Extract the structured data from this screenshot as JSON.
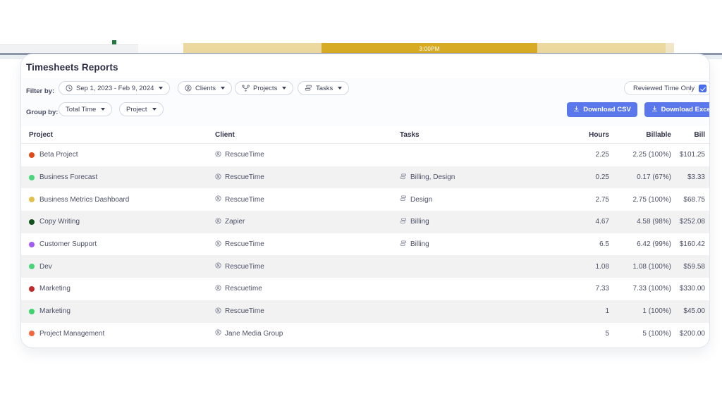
{
  "background": {
    "timeline_label": "3:00PM",
    "colors": {
      "segment_light": "#ecd9a0",
      "segment_dark": "#d8ab25",
      "panel": "#f1f2f4",
      "marker_dot": "#1f7a3d"
    }
  },
  "card": {
    "title": "Timesheets Reports"
  },
  "toolbar": {
    "filter_label": "Filter by:",
    "group_label": "Group by:",
    "filters": [
      {
        "label": "Sep 1, 2023 - Feb 9, 2024",
        "icon": "clock-icon",
        "name": "date-range"
      },
      {
        "label": "Clients",
        "icon": "client-person-icon",
        "name": "clients"
      },
      {
        "label": "Projects",
        "icon": "projects-network-icon",
        "name": "projects"
      },
      {
        "label": "Tasks",
        "icon": "tasks-stack-icon",
        "name": "tasks"
      }
    ],
    "groups": [
      {
        "label": "Total Time",
        "name": "total-time"
      },
      {
        "label": "Project",
        "name": "project"
      }
    ],
    "reviewed_toggle": {
      "label": "Reviewed Time Only",
      "checked": true,
      "accent": "#4a6ef0"
    },
    "download_csv": {
      "label": "Download CSV",
      "icon": "download-icon"
    },
    "download_excel": {
      "label": "Download Excel",
      "icon": "download-icon"
    },
    "button_color": "#5a77ec"
  },
  "table": {
    "columns": {
      "project": "Project",
      "client": "Client",
      "tasks": "Tasks",
      "hours": "Hours",
      "billable": "Billable",
      "bill": "Bill"
    },
    "rows": [
      {
        "dot": "#e24a17",
        "project": "Beta Project",
        "client": "RescueTime",
        "tasks": "",
        "hours": "2.25",
        "billable": "2.25 (100%)",
        "bill": "$101.25"
      },
      {
        "dot": "#4bd47a",
        "project": "Business Forecast",
        "client": "RescueTime",
        "tasks": "Billing, Design",
        "hours": "0.25",
        "billable": "0.17 (67%)",
        "bill": "$3.33"
      },
      {
        "dot": "#e3c04a",
        "project": "Business Metrics Dashboard",
        "client": "RescueTime",
        "tasks": "Design",
        "hours": "2.75",
        "billable": "2.75 (100%)",
        "bill": "$68.75"
      },
      {
        "dot": "#13521f",
        "project": "Copy Writing",
        "client": "Zapier",
        "tasks": "Billing",
        "hours": "4.67",
        "billable": "4.58 (98%)",
        "bill": "$252.08"
      },
      {
        "dot": "#a259f5",
        "project": "Customer Support",
        "client": "RescueTime",
        "tasks": "Billing",
        "hours": "6.5",
        "billable": "6.42 (99%)",
        "bill": "$160.42"
      },
      {
        "dot": "#4bd47a",
        "project": "Dev",
        "client": "RescueTime",
        "tasks": "",
        "hours": "1.08",
        "billable": "1.08 (100%)",
        "bill": "$59.58"
      },
      {
        "dot": "#c42a2a",
        "project": "Marketing",
        "client": "Rescuetime",
        "tasks": "",
        "hours": "7.33",
        "billable": "7.33 (100%)",
        "bill": "$330.00"
      },
      {
        "dot": "#3dd46e",
        "project": "Marketing",
        "client": "RescueTime",
        "tasks": "",
        "hours": "1",
        "billable": "1 (100%)",
        "bill": "$45.00"
      },
      {
        "dot": "#f2683c",
        "project": "Project Management",
        "client": "Jane Media Group",
        "tasks": "",
        "hours": "5",
        "billable": "5 (100%)",
        "bill": "$200.00"
      }
    ]
  }
}
